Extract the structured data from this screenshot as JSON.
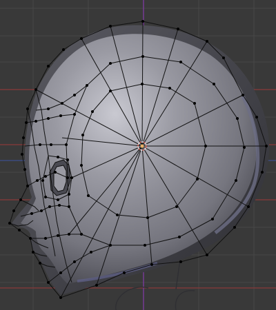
{
  "viewport": {
    "view": "side",
    "mode": "edit",
    "object": "head-mesh",
    "colors": {
      "background": "#393939",
      "grid": "#474747",
      "axis_x": "#8a3a3a",
      "axis_y": "#3d4f8f",
      "axis_vertical": "#7a3a9a",
      "mesh_shade": "#8a8a94",
      "mesh_edge": "#111111",
      "vertex": "#000000",
      "origin": "#e8b26a",
      "outline_rim": "#6d6e86"
    }
  }
}
